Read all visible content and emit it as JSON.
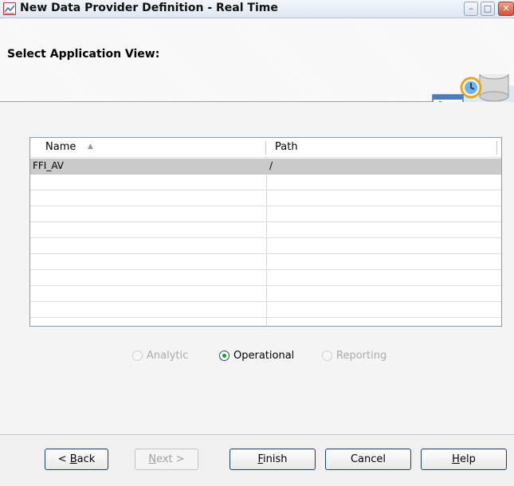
{
  "window": {
    "title": "New Data Provider Definition - Real Time",
    "minimize_icon": "minimize-icon",
    "maximize_icon": "maximize-icon",
    "close_icon": "close-icon"
  },
  "header": {
    "title": "Select Application View:",
    "art_icon": "database-clock-icon"
  },
  "grid": {
    "columns": [
      "Name",
      "Path"
    ],
    "sort_column": "Name",
    "sort_direction": "ascending",
    "rows": [
      {
        "name": "FFI_AV",
        "path": "/",
        "selected": true
      }
    ],
    "empty_rows": 9
  },
  "view_type": {
    "options": [
      {
        "label": "Analytic",
        "selected": false,
        "enabled": false
      },
      {
        "label": "Operational",
        "selected": true,
        "enabled": true
      },
      {
        "label": "Reporting",
        "selected": false,
        "enabled": false
      }
    ]
  },
  "buttons": {
    "back": {
      "prefix": "< ",
      "mnemonic": "B",
      "rest": "ack",
      "enabled": true
    },
    "next": {
      "mnemonic": "N",
      "rest": "ext >",
      "enabled": false
    },
    "finish": {
      "mnemonic": "F",
      "rest": "inish",
      "enabled": true
    },
    "cancel": {
      "label": "Cancel",
      "enabled": true
    },
    "help": {
      "mnemonic": "H",
      "rest": "elp",
      "enabled": true
    }
  },
  "colors": {
    "selected_row": "#cacaca",
    "radio_dot": "#21a121",
    "button_border": "#1d3f66"
  }
}
